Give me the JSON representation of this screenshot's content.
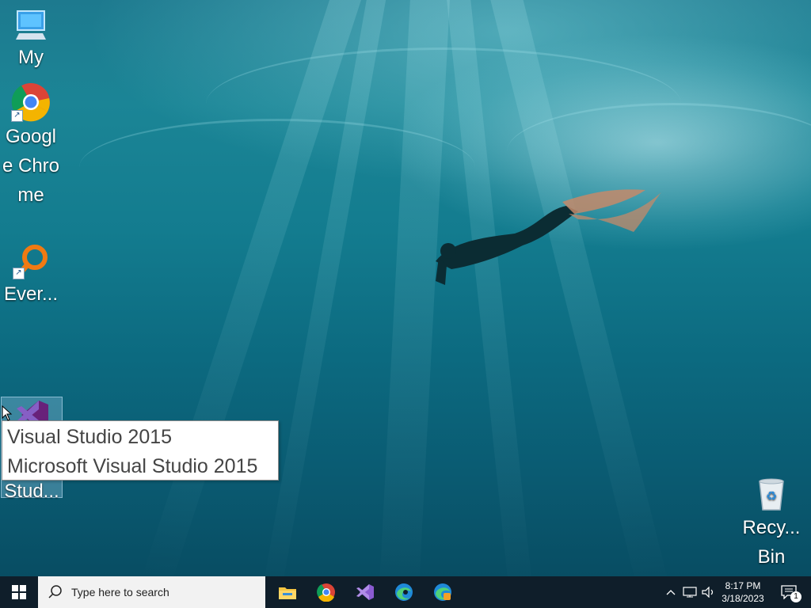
{
  "desktop": {
    "icons": [
      {
        "name": "this-pc",
        "label": "My"
      },
      {
        "name": "google-chrome",
        "label": "Google Chrome"
      },
      {
        "name": "everything",
        "label": "Ever..."
      },
      {
        "name": "visual-studio",
        "label": "Stud..."
      },
      {
        "name": "recycle-bin",
        "label": "Recy... Bin"
      }
    ],
    "tooltip": {
      "line1": "Visual Studio 2015",
      "line2": "Microsoft Visual Studio 2015"
    }
  },
  "taskbar": {
    "search_placeholder": "Type here to search",
    "pinned": [
      "file-explorer-icon",
      "chrome-icon",
      "visual-studio-icon",
      "edge-icon",
      "edge-beta-icon"
    ],
    "clock": {
      "time": "8:17 PM",
      "date": "3/18/2023"
    },
    "notification_count": "1"
  },
  "colors": {
    "taskbar": "#0f1e2a",
    "search_bg": "#f2f2f2",
    "vs_purple": "#68217a"
  }
}
